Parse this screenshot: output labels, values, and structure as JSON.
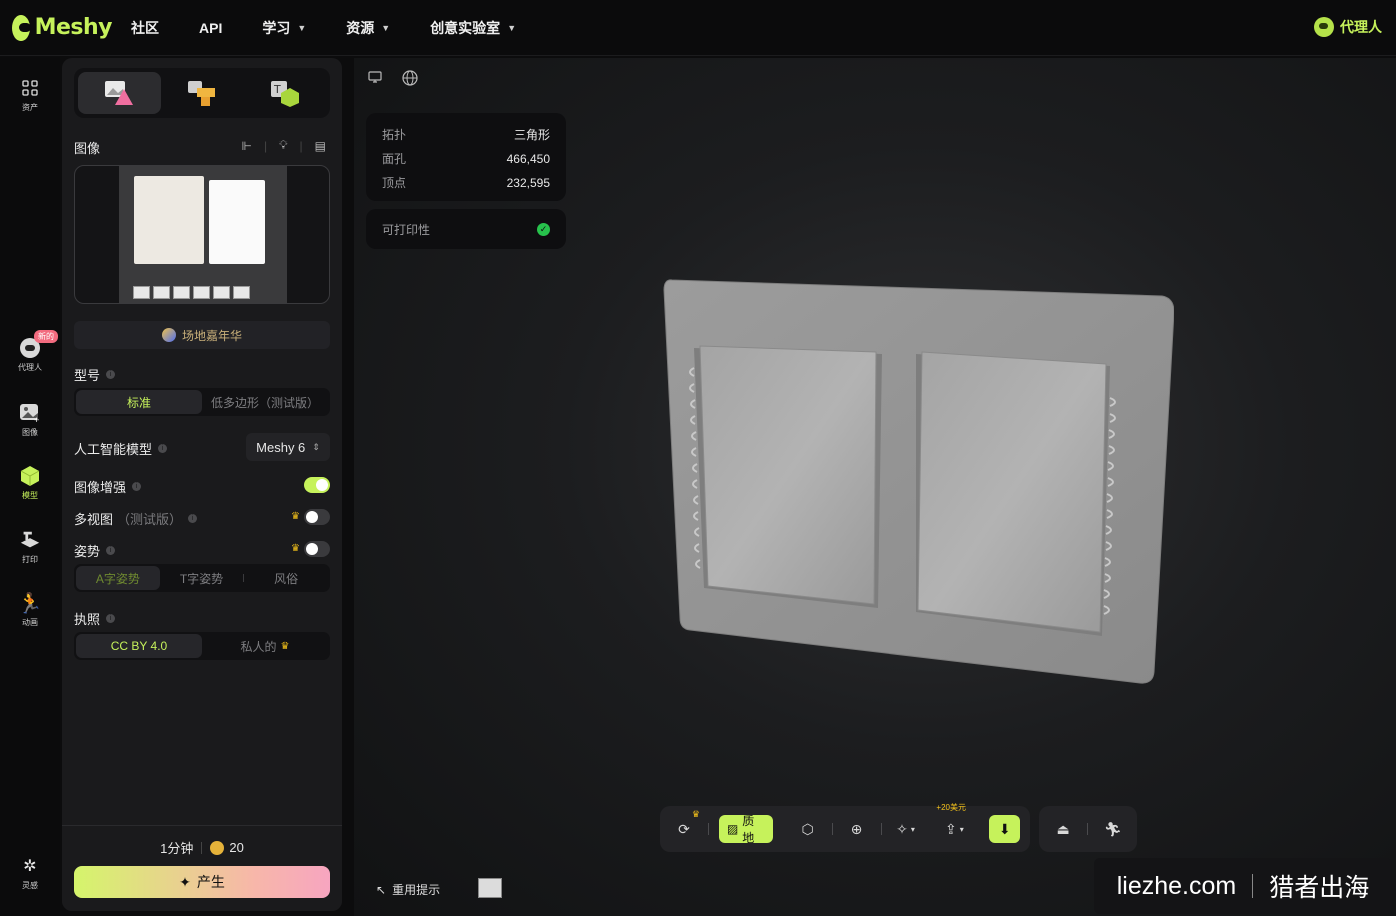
{
  "app": {
    "brand": "Meshy"
  },
  "nav": {
    "items": [
      {
        "label": "社区",
        "dropdown": false
      },
      {
        "label": "API",
        "dropdown": false
      },
      {
        "label": "学习",
        "dropdown": true
      },
      {
        "label": "资源",
        "dropdown": true
      },
      {
        "label": "创意实验室",
        "dropdown": true
      }
    ],
    "agent_label": "代理人"
  },
  "rail": {
    "assets": "资产",
    "agent": "代理人",
    "agent_badge": "新的",
    "image": "图像",
    "model": "模型",
    "print": "打印",
    "animate": "动画",
    "inspiration": "灵感"
  },
  "panel": {
    "image_title": "图像",
    "promo": "场地嘉年华",
    "type_title": "型号",
    "type_options": [
      "标准",
      "低多边形（测试版）"
    ],
    "ai_model_title": "人工智能模型",
    "ai_model_value": "Meshy 6",
    "enhance_title": "图像增强",
    "enhance_on": true,
    "multiview_title": "多视图",
    "multiview_note": "（测试版）",
    "multiview_on": false,
    "pose_title": "姿势",
    "pose_on": false,
    "pose_options": [
      "A字姿势",
      "T字姿势",
      "风俗"
    ],
    "license_title": "执照",
    "license_options": [
      "CC BY 4.0",
      "私人的"
    ],
    "time": "1分钟",
    "credits": "20",
    "generate": "产生"
  },
  "viewport": {
    "stats": [
      {
        "k": "拓扑",
        "v": "三角形"
      },
      {
        "k": "面孔",
        "v": "466,450"
      },
      {
        "k": "顶点",
        "v": "232,595"
      }
    ],
    "printable": "可打印性",
    "texture_btn": "质地",
    "export_bonus": "+20美元",
    "reuse_prompt": "重用提示"
  },
  "watermark": {
    "domain": "liezhe.com",
    "name": "猎者出海"
  },
  "colors": {
    "accent": "#c6f25b",
    "bg": "#0c0c0d",
    "panel": "#1a1a1c"
  }
}
